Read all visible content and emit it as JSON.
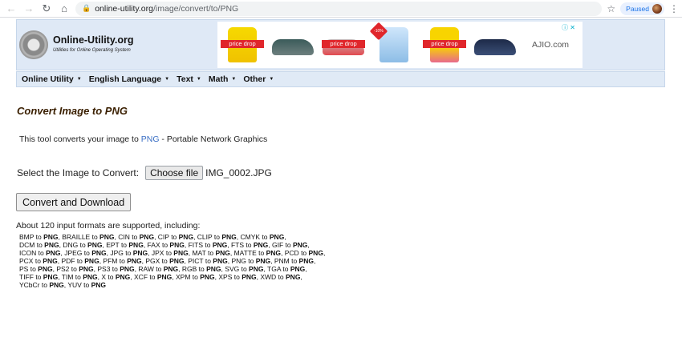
{
  "browser": {
    "url_domain": "online-utility.org",
    "url_path": "/image/convert/to/PNG",
    "profile_status": "Paused"
  },
  "header": {
    "logo_title": "Online-Utility.org",
    "logo_subtitle": "Utilities for Online Operating System",
    "ad": {
      "tags": [
        "price drop",
        "price drop",
        "price drop"
      ],
      "discount": "-10%",
      "brand": "AJIO.com"
    }
  },
  "nav": {
    "items": [
      "Online Utility",
      "English Language",
      "Text",
      "Math",
      "Other"
    ]
  },
  "main": {
    "title": "Convert Image to PNG",
    "intro_before": "This tool converts your image to ",
    "intro_link": "PNG",
    "intro_after": " - Portable Network Graphics",
    "select_label": "Select the Image to Convert:",
    "choose_file_label": "Choose file",
    "file_name": "IMG_0002.JPG",
    "convert_label": "Convert and Download",
    "formats_heading": "About 120 input formats are supported, including:",
    "target_format": "PNG",
    "formats": [
      "BMP",
      "BRAILLE",
      "CIN",
      "CIP",
      "CLIP",
      "CMYK",
      "DCM",
      "DNG",
      "EPT",
      "FAX",
      "FITS",
      "FTS",
      "GIF",
      "ICON",
      "JPEG",
      "JPG",
      "JPX",
      "MAT",
      "MATTE",
      "PCD",
      "PCX",
      "PDF",
      "PFM",
      "PGX",
      "PICT",
      "PNG",
      "PNM",
      "PS",
      "PS2",
      "PS3",
      "RAW",
      "RGB",
      "SVG",
      "TGA",
      "TIFF",
      "TIM",
      "X",
      "XCF",
      "XPM",
      "XPS",
      "XWD",
      "YCbCr",
      "YUV"
    ],
    "format_rows": [
      [
        "BMP",
        "BRAILLE",
        "CIN",
        "CIP",
        "CLIP",
        "CMYK"
      ],
      [
        "DCM",
        "DNG",
        "EPT",
        "FAX",
        "FITS",
        "FTS",
        "GIF"
      ],
      [
        "ICON",
        "JPEG",
        "JPG",
        "JPX",
        "MAT",
        "MATTE",
        "PCD"
      ],
      [
        "PCX",
        "PDF",
        "PFM",
        "PGX",
        "PICT",
        "PNG",
        "PNM"
      ],
      [
        "PS",
        "PS2",
        "PS3",
        "RAW",
        "RGB",
        "SVG",
        "TGA"
      ],
      [
        "TIFF",
        "TIM",
        "X",
        "XCF",
        "XPM",
        "XPS",
        "XWD"
      ],
      [
        "YCbCr",
        "YUV"
      ]
    ]
  }
}
